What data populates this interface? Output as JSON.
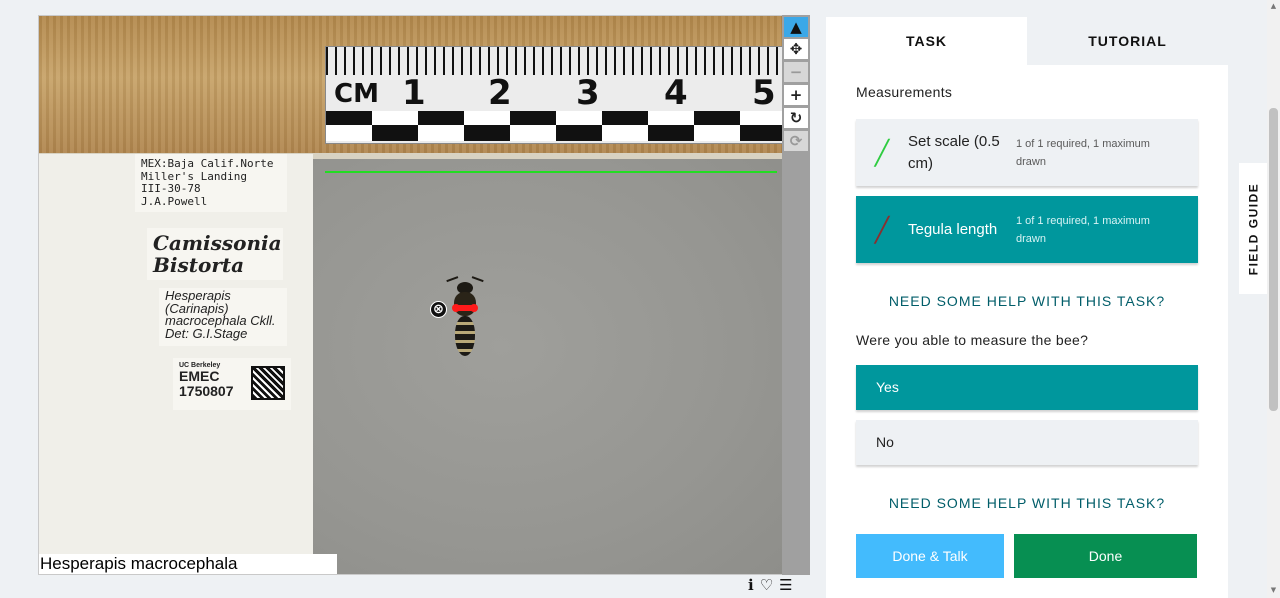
{
  "subject": {
    "caption": "Hesperapis macrocephala",
    "ruler": {
      "unit": "CM",
      "numbers": [
        "1",
        "2",
        "3",
        "4",
        "5"
      ]
    },
    "labels": {
      "locality": [
        "MEX:Baja Calif.Norte",
        "Miller's Landing",
        "III-30-78",
        "J.A.Powell"
      ],
      "host_plant": [
        "Camissonia",
        "Bistorta"
      ],
      "determination": [
        "Hesperapis",
        "(Carinapis)",
        "macrocephala Ckll.",
        "Det: G.I.Stage"
      ],
      "collection": {
        "institution": "UC Berkeley",
        "code": "EMEC",
        "number": "1750807"
      }
    },
    "delete_mark": "⊗"
  },
  "toolbar": {
    "tools": [
      {
        "name": "pointer-tool",
        "icon": "▲"
      },
      {
        "name": "pan-tool",
        "icon": "✥"
      },
      {
        "name": "zoom-out-tool",
        "icon": "−"
      },
      {
        "name": "zoom-in-tool",
        "icon": "+"
      },
      {
        "name": "rotate-tool",
        "icon": "↻"
      },
      {
        "name": "reset-tool",
        "icon": "⟳"
      }
    ]
  },
  "meta": {
    "info_icon": "ℹ",
    "favorite_icon": "♡",
    "collections_icon": "☰"
  },
  "panel": {
    "tabs": {
      "task": "TASK",
      "tutorial": "TUTORIAL"
    },
    "section_title": "Measurements",
    "drawing_tools": [
      {
        "label": "Set scale (0.5 cm)",
        "requirement": "1 of 1 required, 1 maximum drawn",
        "color": "#2ecc40"
      },
      {
        "label": "Tegula length",
        "requirement": "1 of 1 required, 1 maximum drawn",
        "color": "#8a2f2f"
      }
    ],
    "help_link": "NEED SOME HELP WITH THIS TASK?",
    "question": "Were you able to measure the bee?",
    "answers": {
      "yes": "Yes",
      "no": "No"
    },
    "buttons": {
      "done_talk": "Done & Talk",
      "done": "Done"
    }
  },
  "field_guide": "FIELD GUIDE",
  "colors": {
    "teal": "#00979d",
    "talk_blue": "#43bbfd",
    "done_green": "#078f52",
    "help_text": "#005d69"
  }
}
